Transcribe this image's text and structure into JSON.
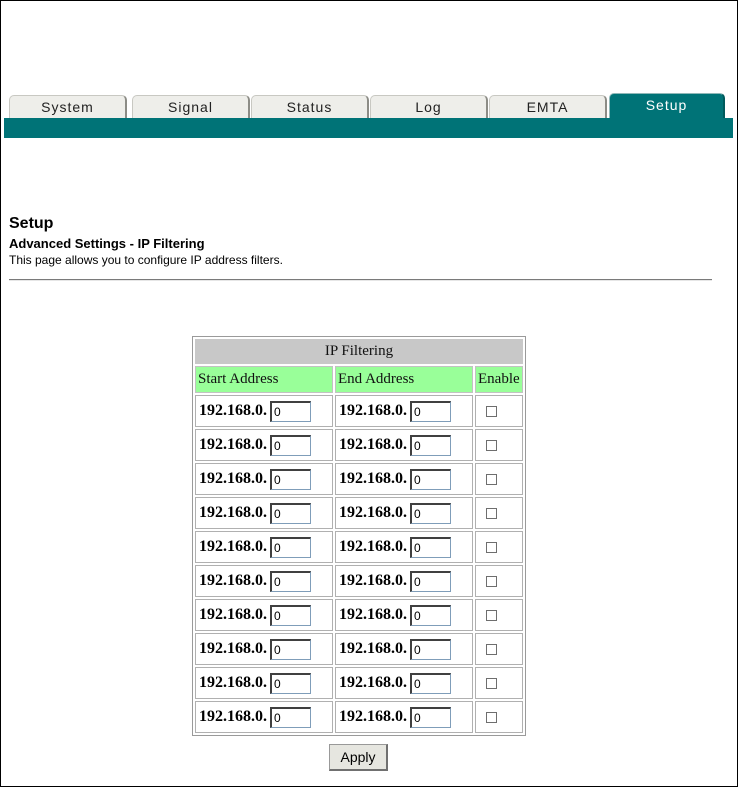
{
  "tabs": [
    {
      "label": "System",
      "active": false
    },
    {
      "label": "Signal",
      "active": false
    },
    {
      "label": "Status",
      "active": false
    },
    {
      "label": "Log",
      "active": false
    },
    {
      "label": "EMTA",
      "active": false
    },
    {
      "label": "Setup",
      "active": true
    }
  ],
  "colors": {
    "accent": "#007377",
    "header_green": "#99ff99",
    "caption_gray": "#c8c8c8"
  },
  "page": {
    "title": "Setup",
    "subtitle": "Advanced Settings - IP Filtering",
    "description": "This page allows you to configure IP address filters."
  },
  "table": {
    "caption": "IP Filtering",
    "headers": {
      "start": "Start Address",
      "end": "End Address",
      "enable": "Enable"
    },
    "rows": [
      {
        "start_prefix": "192.168.0.",
        "start_value": "0",
        "end_prefix": "192.168.0.",
        "end_value": "0",
        "enabled": false
      },
      {
        "start_prefix": "192.168.0.",
        "start_value": "0",
        "end_prefix": "192.168.0.",
        "end_value": "0",
        "enabled": false
      },
      {
        "start_prefix": "192.168.0.",
        "start_value": "0",
        "end_prefix": "192.168.0.",
        "end_value": "0",
        "enabled": false
      },
      {
        "start_prefix": "192.168.0.",
        "start_value": "0",
        "end_prefix": "192.168.0.",
        "end_value": "0",
        "enabled": false
      },
      {
        "start_prefix": "192.168.0.",
        "start_value": "0",
        "end_prefix": "192.168.0.",
        "end_value": "0",
        "enabled": false
      },
      {
        "start_prefix": "192.168.0.",
        "start_value": "0",
        "end_prefix": "192.168.0.",
        "end_value": "0",
        "enabled": false
      },
      {
        "start_prefix": "192.168.0.",
        "start_value": "0",
        "end_prefix": "192.168.0.",
        "end_value": "0",
        "enabled": false
      },
      {
        "start_prefix": "192.168.0.",
        "start_value": "0",
        "end_prefix": "192.168.0.",
        "end_value": "0",
        "enabled": false
      },
      {
        "start_prefix": "192.168.0.",
        "start_value": "0",
        "end_prefix": "192.168.0.",
        "end_value": "0",
        "enabled": false
      },
      {
        "start_prefix": "192.168.0.",
        "start_value": "0",
        "end_prefix": "192.168.0.",
        "end_value": "0",
        "enabled": false
      }
    ]
  },
  "apply_label": "Apply"
}
